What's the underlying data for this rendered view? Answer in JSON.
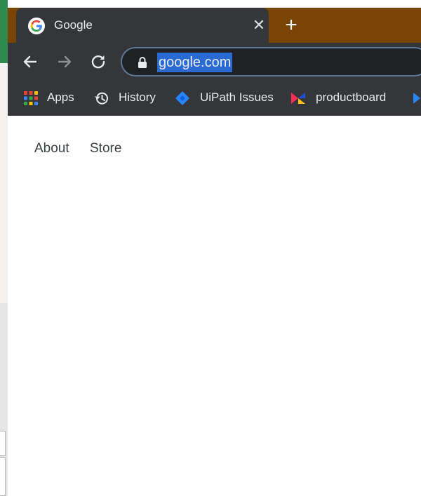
{
  "browser": {
    "tab": {
      "title": "Google",
      "favicon": "google-g-icon",
      "close_icon": "close-icon"
    },
    "new_tab_icon": "plus-icon",
    "toolbar": {
      "back_icon": "arrow-left-icon",
      "forward_icon": "arrow-right-icon",
      "reload_icon": "reload-icon",
      "lock_icon": "lock-icon",
      "url": "google.com"
    },
    "bookmarks": [
      {
        "label": "Apps",
        "icon": "apps-grid-icon"
      },
      {
        "label": "History",
        "icon": "history-icon"
      },
      {
        "label": "UiPath Issues",
        "icon": "jira-icon"
      },
      {
        "label": "productboard",
        "icon": "productboard-icon"
      }
    ],
    "colors": {
      "frame": "#35363a",
      "tabstrip": "#7a4405",
      "url_selection": "#2a6bd3"
    }
  },
  "page": {
    "links": [
      {
        "label": "About"
      },
      {
        "label": "Store"
      }
    ]
  }
}
